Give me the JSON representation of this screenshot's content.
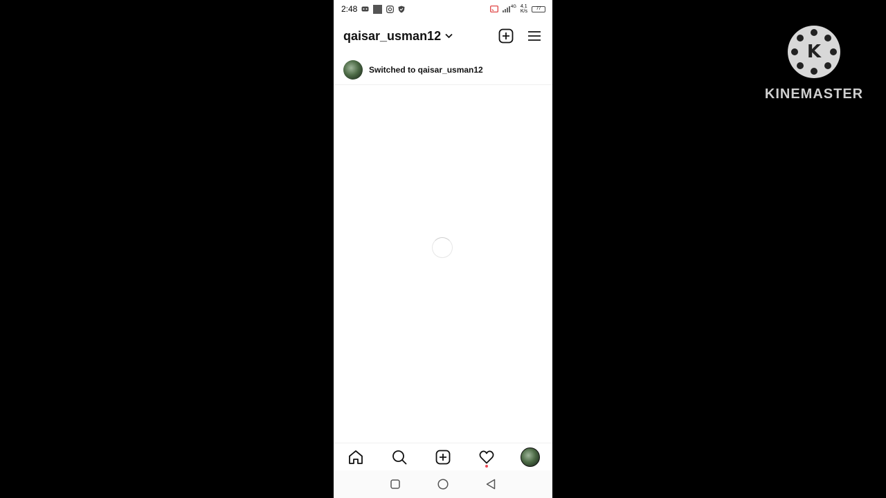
{
  "status_bar": {
    "time": "2:48",
    "battery": "77",
    "network_type": "4G",
    "speed_value": "4.1",
    "speed_unit": "K/s"
  },
  "header": {
    "username": "qaisar_usman12"
  },
  "notice": {
    "text": "Switched to qaisar_usman12"
  },
  "bottom_nav": {
    "items": [
      "home-icon",
      "search-icon",
      "create-icon",
      "activity-heart-icon",
      "profile-avatar"
    ]
  },
  "watermark": {
    "text": "KINEMASTER",
    "logo_letter": "K"
  },
  "colors": {
    "background": "#000000",
    "app_bg": "#ffffff",
    "notification_dot": "#ed4956"
  }
}
